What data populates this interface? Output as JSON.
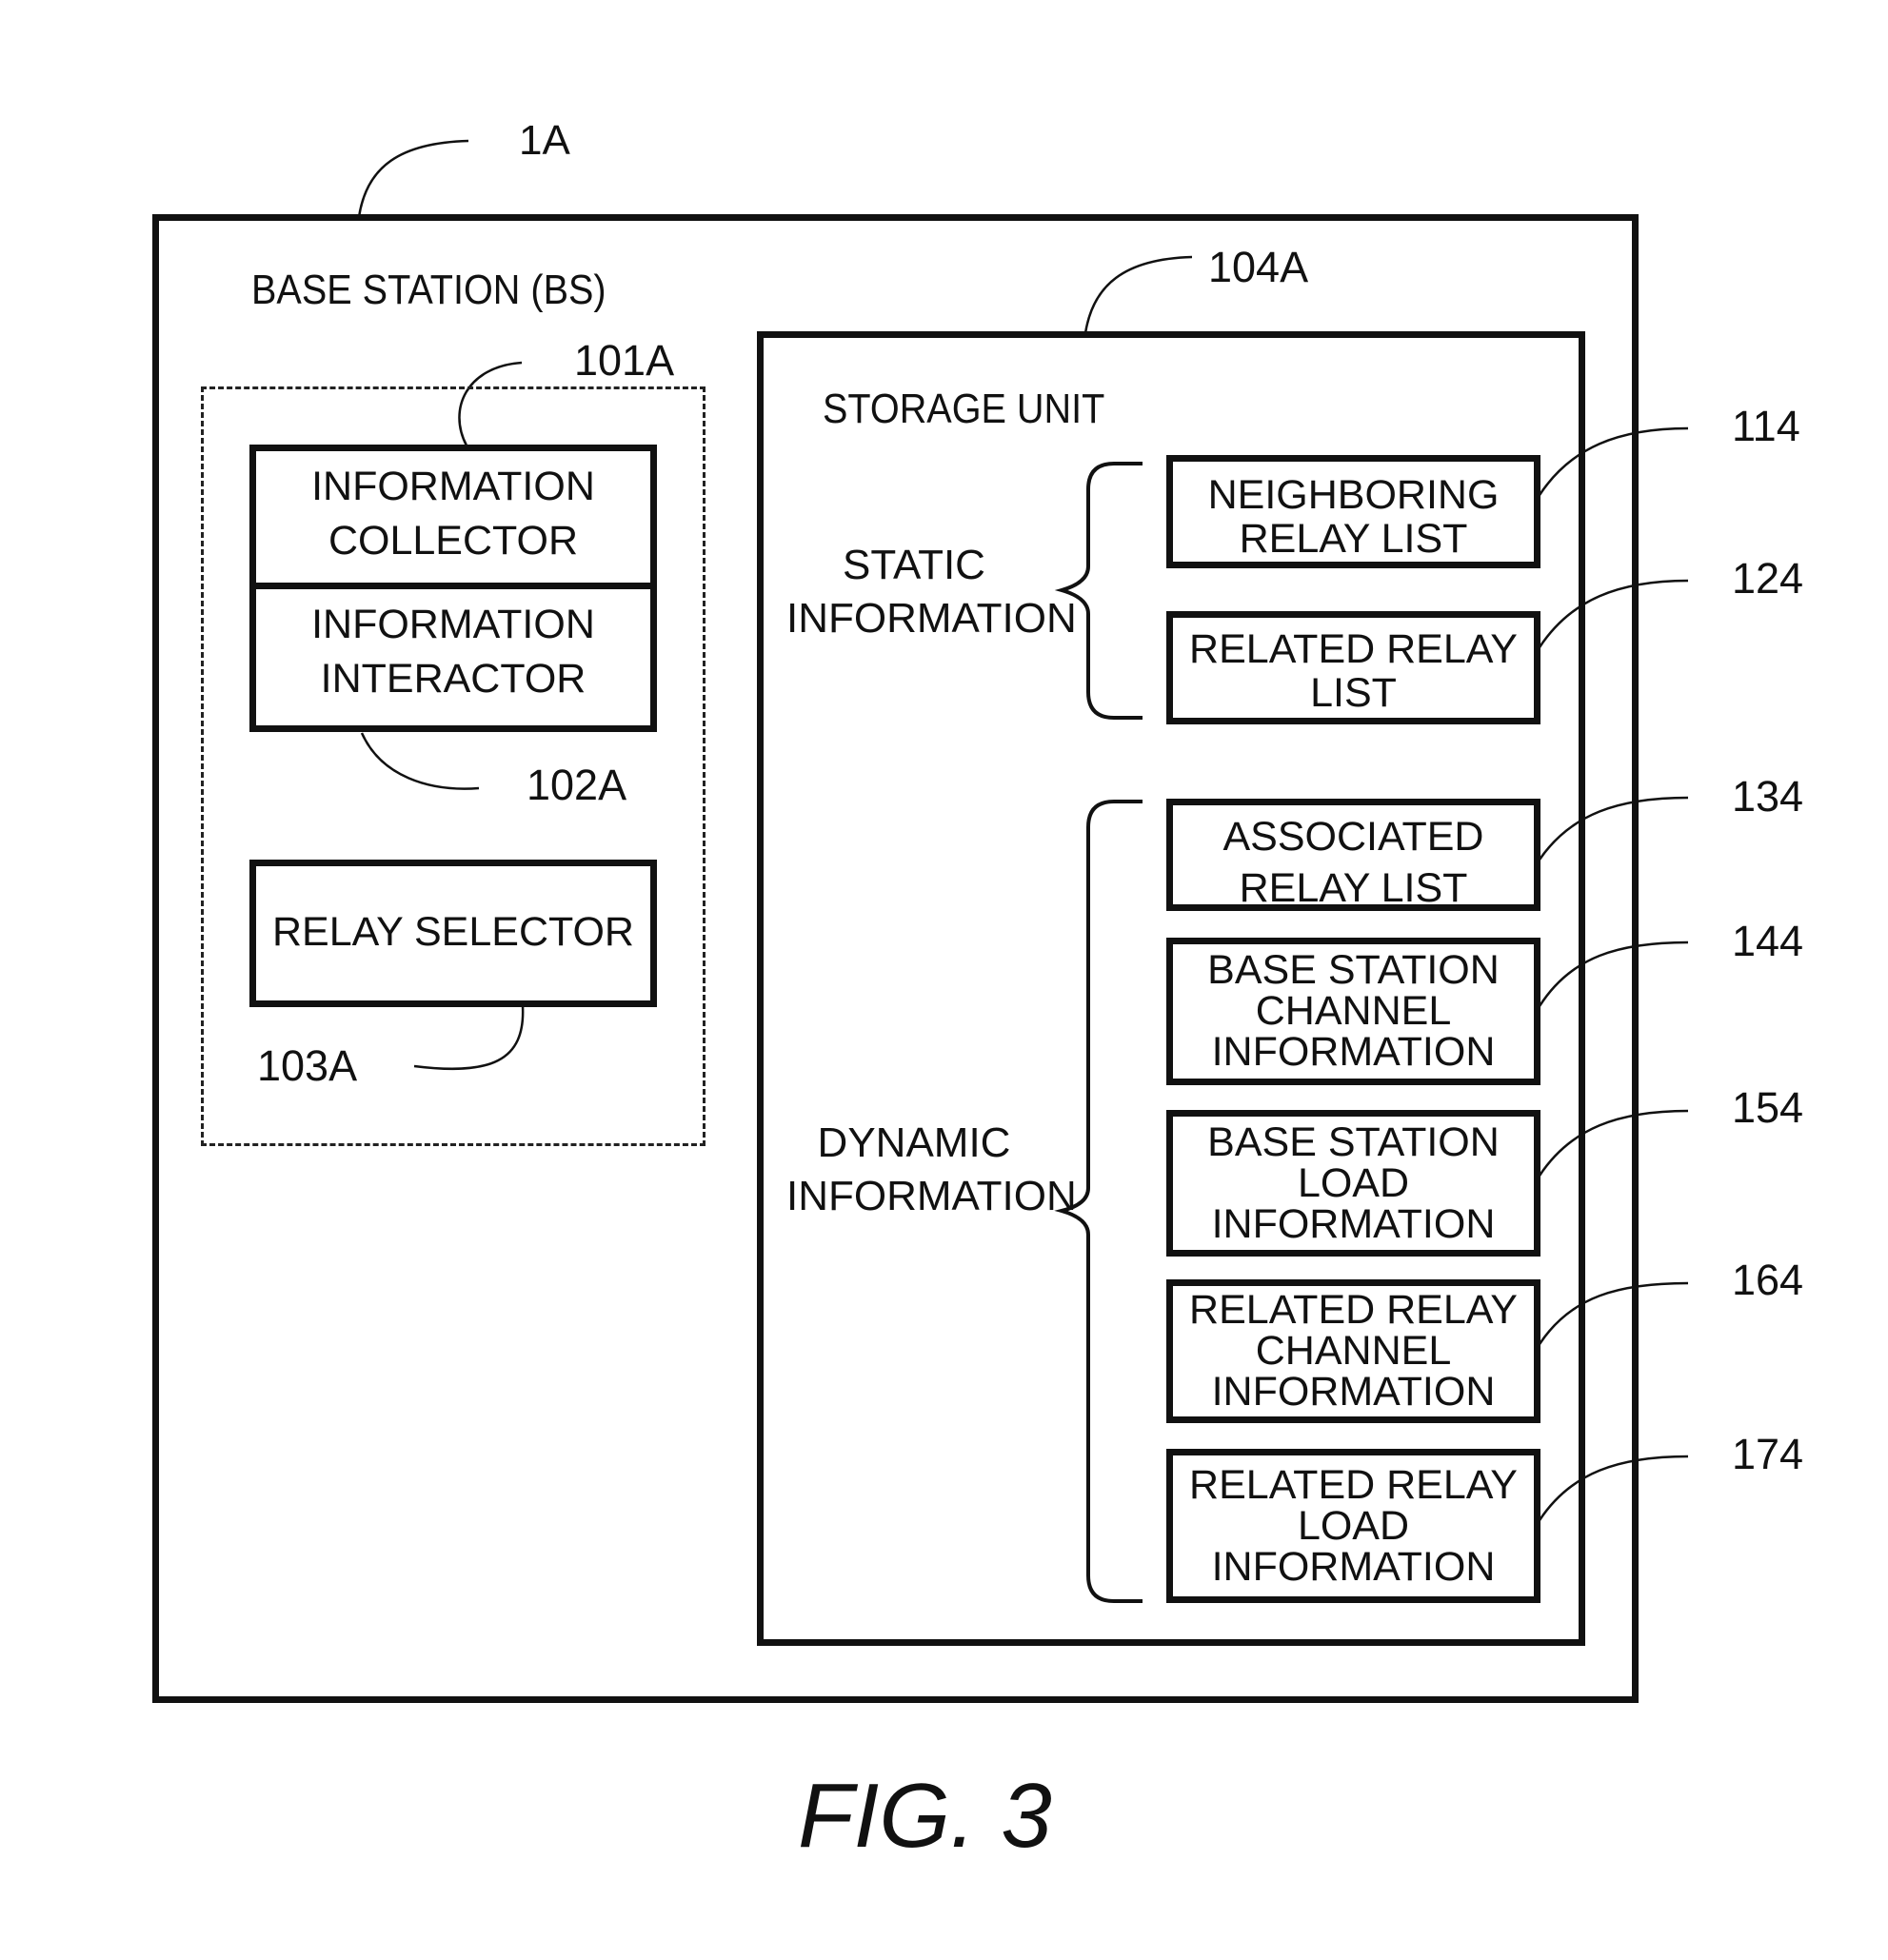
{
  "figure": {
    "caption": "FIG. 3"
  },
  "base_station": {
    "ref": "1A",
    "title": "BASE STATION (BS)",
    "group_ref": "101A",
    "information_collector": {
      "lines": [
        "INFORMATION",
        "COLLECTOR"
      ]
    },
    "information_interactor": {
      "ref": "102A",
      "lines": [
        "INFORMATION",
        "INTERACTOR"
      ]
    },
    "relay_selector": {
      "ref": "103A",
      "label": "RELAY SELECTOR"
    }
  },
  "storage_unit": {
    "ref": "104A",
    "title": "STORAGE UNIT",
    "static_group": {
      "lines": [
        "STATIC",
        "INFORMATION"
      ],
      "items": [
        {
          "ref": "114",
          "lines": [
            "NEIGHBORING",
            "RELAY LIST"
          ]
        },
        {
          "ref": "124",
          "lines": [
            "RELATED RELAY",
            "LIST"
          ]
        }
      ]
    },
    "dynamic_group": {
      "lines": [
        "DYNAMIC",
        "INFORMATION"
      ],
      "items": [
        {
          "ref": "134",
          "lines": [
            "ASSOCIATED",
            "RELAY LIST"
          ]
        },
        {
          "ref": "144",
          "lines": [
            "BASE STATION",
            "CHANNEL",
            "INFORMATION"
          ]
        },
        {
          "ref": "154",
          "lines": [
            "BASE STATION",
            "LOAD",
            "INFORMATION"
          ]
        },
        {
          "ref": "164",
          "lines": [
            "RELATED RELAY",
            "CHANNEL",
            "INFORMATION"
          ]
        },
        {
          "ref": "174",
          "lines": [
            "RELATED RELAY",
            "LOAD",
            "INFORMATION"
          ]
        }
      ]
    }
  }
}
